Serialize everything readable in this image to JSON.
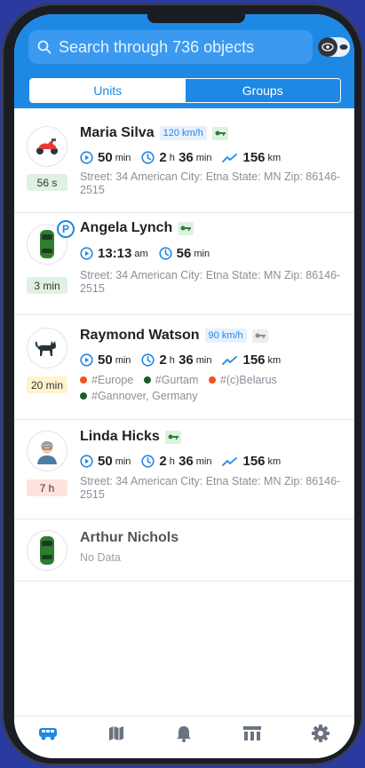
{
  "search": {
    "placeholder": "Search through 736 objects"
  },
  "tabs": {
    "units": "Units",
    "groups": "Groups"
  },
  "colors": {
    "accent": "#1e88e5",
    "dot_orange": "#f4511e",
    "dot_green": "#1b5e20"
  },
  "units": [
    {
      "name": "Maria Silva",
      "speed": "120 km/h",
      "icon": "scooter-icon",
      "badge": "56 s",
      "stats": [
        {
          "icon": "play-circle-icon",
          "value": "50",
          "unit": "min"
        },
        {
          "icon": "clock-icon",
          "value_a": "2",
          "unit_a": "h",
          "value_b": "36",
          "unit_b": "min"
        },
        {
          "icon": "trend-icon",
          "value": "156",
          "unit": "km"
        }
      ],
      "address": "Street: 34 American City: Etna State: MN Zip: 86146-2515"
    },
    {
      "name": "Angela Lynch",
      "icon": "car-icon",
      "badge": "3 min",
      "stats": [
        {
          "icon": "play-circle-icon",
          "value": "13:13",
          "unit": "am"
        },
        {
          "icon": "clock-icon",
          "value": "56",
          "unit": "min"
        }
      ],
      "address": "Street: 34 American City: Etna State: MN Zip: 86146-2515"
    },
    {
      "name": "Raymond Watson",
      "speed": "90 km/h",
      "icon": "cat-icon",
      "badge": "20 min",
      "stats": [
        {
          "icon": "play-circle-icon",
          "value": "50",
          "unit": "min"
        },
        {
          "icon": "clock-icon",
          "value_a": "2",
          "unit_a": "h",
          "value_b": "36",
          "unit_b": "min"
        },
        {
          "icon": "trend-icon",
          "value": "156",
          "unit": "km"
        }
      ],
      "tags": [
        "#Europe",
        "#Gurtam",
        "#(c)Belarus",
        "#Gannover, Germany"
      ]
    },
    {
      "name": "Linda Hicks",
      "icon": "person-icon",
      "badge": "7 h",
      "stats": [
        {
          "icon": "play-circle-icon",
          "value": "50",
          "unit": "min"
        },
        {
          "icon": "clock-icon",
          "value_a": "2",
          "unit_a": "h",
          "value_b": "36",
          "unit_b": "min"
        },
        {
          "icon": "trend-icon",
          "value": "156",
          "unit": "km"
        }
      ],
      "address": "Street: 34 American City: Etna State: MN Zip: 86146-2515"
    },
    {
      "name": "Arthur Nichols",
      "icon": "car-icon",
      "status": "No Data"
    }
  ],
  "tabbar": [
    "units-tab-icon",
    "map-tab-icon",
    "notifications-tab-icon",
    "reports-tab-icon",
    "settings-tab-icon"
  ]
}
